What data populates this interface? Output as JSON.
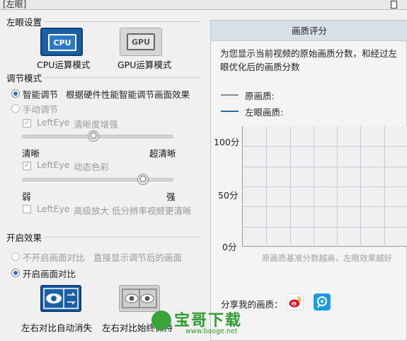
{
  "window": {
    "title": "[左眼]"
  },
  "left": {
    "settings_title": "左眼设置",
    "modes": [
      {
        "chip": "CPU",
        "label": "CPU运算模式",
        "active": true
      },
      {
        "chip": "GPU",
        "label": "GPU运算模式",
        "active": false
      }
    ],
    "adjust_title": "调节模式",
    "smart": {
      "label": "智能调节",
      "desc": "根据硬件性能智能调节画面效果",
      "selected": true
    },
    "manual": {
      "label": "手动调节",
      "selected": false
    },
    "sharpness": {
      "check_label": "LeftEye",
      "desc": "清晰度增强",
      "checked": true,
      "level": 0.47,
      "min_label": "清晰",
      "max_label": "超清晰"
    },
    "color": {
      "check_label": "LeftEye",
      "desc": "动态色彩",
      "checked": true,
      "level": 0.8,
      "min_label": "弱",
      "max_label": "强"
    },
    "zoom": {
      "check_label": "LeftEye",
      "desc": "高级放大 低分辨率视频更清晰",
      "checked": false
    },
    "effect_title": "开启效果",
    "no_compare": {
      "label": "不开启画面对比",
      "desc": "直接显示调节后的画面",
      "selected": false
    },
    "compare": {
      "label": "开启画面对比",
      "selected": true
    },
    "compare_buttons": [
      {
        "label": "左右对比自动消失",
        "active": true
      },
      {
        "label": "左右对比始终保持",
        "active": false
      }
    ]
  },
  "right": {
    "header": "画质评分",
    "description": "为您显示当前视频的原始画质分数，和经过左眼优化后的画质分数",
    "legend": [
      {
        "label": "原画质:",
        "color": "#8c8c8c"
      },
      {
        "label": "左眼画质:",
        "color": "#2a6f9e"
      }
    ],
    "caption": "原画质基准分数越高，左眼效果越好",
    "share_label": "分享我的画质：",
    "share_icons": [
      "weibo-icon",
      "tencent-weibo-icon"
    ]
  },
  "chart_data": {
    "type": "line",
    "y_ticks": [
      "100分",
      "50分",
      "0分"
    ],
    "ylim": [
      0,
      100
    ],
    "series": [],
    "grid": true
  },
  "watermark": {
    "text": "宝哥下载",
    "url": "www.baoge.net"
  }
}
